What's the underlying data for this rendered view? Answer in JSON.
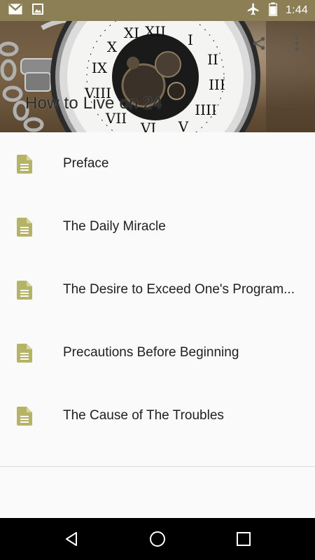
{
  "status_bar": {
    "time": "1:44",
    "left_icons": [
      "gmail-icon",
      "image-icon"
    ],
    "right_icons": [
      "airplane-mode-icon",
      "battery-icon"
    ]
  },
  "header": {
    "title": "How to Live on 24",
    "actions": [
      "share-icon",
      "overflow-menu-icon"
    ]
  },
  "chapters": [
    {
      "label": "Preface"
    },
    {
      "label": "The Daily Miracle"
    },
    {
      "label": "The Desire to Exceed One's Program..."
    },
    {
      "label": "Precautions Before Beginning"
    },
    {
      "label": "The Cause of The Troubles"
    }
  ],
  "navigation": {
    "buttons": [
      "back-icon",
      "home-icon",
      "recents-icon"
    ]
  },
  "colors": {
    "status_bar": "#8d7f55",
    "doc_icon": "#b5b466",
    "list_background": "#fafafa",
    "nav_bar": "#000000"
  }
}
